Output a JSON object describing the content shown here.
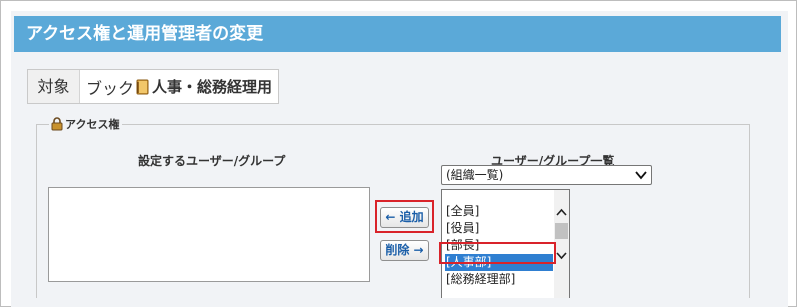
{
  "header": {
    "title": "アクセス権と運用管理者の変更"
  },
  "target": {
    "label": "対象",
    "app": "ブック",
    "name": "人事・総務経理用"
  },
  "access": {
    "legend": "アクセス権",
    "left_title": "設定するユーザー/グループ",
    "right_title": "ユーザー/グループ一覧",
    "select_value": "(組織一覧)",
    "add_label": "← 追加",
    "delete_label": "削除 →",
    "list_items": [
      "[全員]",
      "[役員]",
      "[部長]",
      "[人事部]",
      "[総務経理部]"
    ],
    "selected_item": "[人事部]"
  },
  "colors": {
    "header_bg": "#5ba9d8",
    "highlight": "#d9232a",
    "selection": "#2f7fd1",
    "button_text": "#1a5ea8"
  }
}
